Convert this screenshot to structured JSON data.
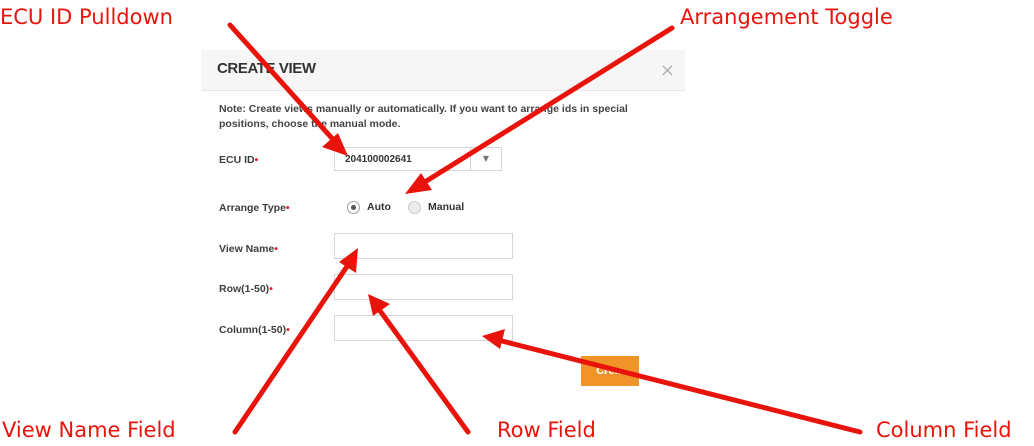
{
  "annotations": {
    "ecu_id_pulldown": "ECU ID Pulldown",
    "arrangement_toggle": "Arrangement Toggle",
    "view_name_field": "View Name Field",
    "row_field": "Row Field",
    "column_field": "Column Field",
    "color": "#e8140c"
  },
  "dialog": {
    "title": "CREATE VIEW",
    "close_icon": "close-icon",
    "note": "Note: Create views manually or automatically. If you want to arrange ids in special positions, choose the manual mode.",
    "required_marker": "•",
    "fields": {
      "ecu_id": {
        "label": "ECU ID",
        "value": "204100002641",
        "arrow_icon": "chevron-down-icon"
      },
      "arrange_type": {
        "label": "Arrange Type",
        "options": [
          "Auto",
          "Manual"
        ],
        "selected": "Auto"
      },
      "view_name": {
        "label": "View Name",
        "value": ""
      },
      "row": {
        "label": "Row(1-50)",
        "value": ""
      },
      "column": {
        "label": "Column(1-50)",
        "value": ""
      }
    },
    "create_button": {
      "label": "Cre..."
    },
    "colors": {
      "accent": "#f0942a",
      "required": "#e5192f"
    }
  }
}
